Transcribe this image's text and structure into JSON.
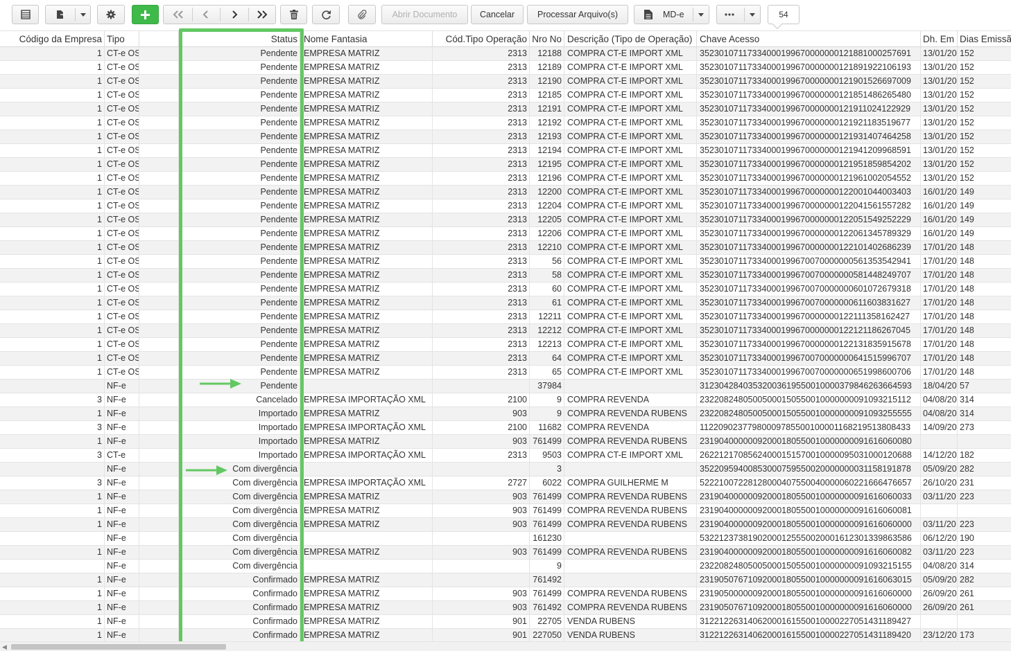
{
  "toolbar": {
    "abrir_label": "Abrir Documento",
    "cancelar_label": "Cancelar",
    "processar_label": "Processar Arquivo(s)",
    "mde_label": "MD-e",
    "page_number": "54",
    "accent_color": "#3fba4a"
  },
  "columns": {
    "codigo": "Código da Empresa",
    "tipo": "Tipo",
    "status": "Status",
    "nome": "Nome Fantasia",
    "codop": "Cód.Tipo Operação",
    "nro": "Nro No",
    "desc": "Descrição (Tipo de Operação)",
    "chave": "Chave Acesso",
    "dh": "Dh. Em",
    "dias": "Dias Emissã"
  },
  "rows": [
    {
      "cod": "1",
      "tipo": "CT-e OS",
      "status": "Pendente",
      "nome": "EMPRESA MATRIZ",
      "codop": "2313",
      "nro": "12188",
      "desc": "COMPRA CT-E IMPORT XML",
      "chave": "35230107117334000199670000000121881000257691",
      "dh": "13/01/20",
      "dias": "152"
    },
    {
      "cod": "1",
      "tipo": "CT-e OS",
      "status": "Pendente",
      "nome": "EMPRESA MATRIZ",
      "codop": "2313",
      "nro": "12189",
      "desc": "COMPRA CT-E IMPORT XML",
      "chave": "35230107117334000199670000000121891922106193",
      "dh": "13/01/20",
      "dias": "152"
    },
    {
      "cod": "1",
      "tipo": "CT-e OS",
      "status": "Pendente",
      "nome": "EMPRESA MATRIZ",
      "codop": "2313",
      "nro": "12190",
      "desc": "COMPRA CT-E IMPORT XML",
      "chave": "35230107117334000199670000000121901526697009",
      "dh": "13/01/20",
      "dias": "152"
    },
    {
      "cod": "1",
      "tipo": "CT-e OS",
      "status": "Pendente",
      "nome": "EMPRESA MATRIZ",
      "codop": "2313",
      "nro": "12185",
      "desc": "COMPRA CT-E IMPORT XML",
      "chave": "35230107117334000199670000000121851486265480",
      "dh": "13/01/20",
      "dias": "152"
    },
    {
      "cod": "1",
      "tipo": "CT-e OS",
      "status": "Pendente",
      "nome": "EMPRESA MATRIZ",
      "codop": "2313",
      "nro": "12191",
      "desc": "COMPRA CT-E IMPORT XML",
      "chave": "35230107117334000199670000000121911024122929",
      "dh": "13/01/20",
      "dias": "152"
    },
    {
      "cod": "1",
      "tipo": "CT-e OS",
      "status": "Pendente",
      "nome": "EMPRESA MATRIZ",
      "codop": "2313",
      "nro": "12192",
      "desc": "COMPRA CT-E IMPORT XML",
      "chave": "35230107117334000199670000000121921183519677",
      "dh": "13/01/20",
      "dias": "152"
    },
    {
      "cod": "1",
      "tipo": "CT-e OS",
      "status": "Pendente",
      "nome": "EMPRESA MATRIZ",
      "codop": "2313",
      "nro": "12193",
      "desc": "COMPRA CT-E IMPORT XML",
      "chave": "35230107117334000199670000000121931407464258",
      "dh": "13/01/20",
      "dias": "152"
    },
    {
      "cod": "1",
      "tipo": "CT-e OS",
      "status": "Pendente",
      "nome": "EMPRESA MATRIZ",
      "codop": "2313",
      "nro": "12194",
      "desc": "COMPRA CT-E IMPORT XML",
      "chave": "35230107117334000199670000000121941209968591",
      "dh": "13/01/20",
      "dias": "152"
    },
    {
      "cod": "1",
      "tipo": "CT-e OS",
      "status": "Pendente",
      "nome": "EMPRESA MATRIZ",
      "codop": "2313",
      "nro": "12195",
      "desc": "COMPRA CT-E IMPORT XML",
      "chave": "35230107117334000199670000000121951859854202",
      "dh": "13/01/20",
      "dias": "152"
    },
    {
      "cod": "1",
      "tipo": "CT-e OS",
      "status": "Pendente",
      "nome": "EMPRESA MATRIZ",
      "codop": "2313",
      "nro": "12196",
      "desc": "COMPRA CT-E IMPORT XML",
      "chave": "35230107117334000199670000000121961002054552",
      "dh": "13/01/20",
      "dias": "152"
    },
    {
      "cod": "1",
      "tipo": "CT-e OS",
      "status": "Pendente",
      "nome": "EMPRESA MATRIZ",
      "codop": "2313",
      "nro": "12200",
      "desc": "COMPRA CT-E IMPORT XML",
      "chave": "35230107117334000199670000000122001044003403",
      "dh": "16/01/20",
      "dias": "149"
    },
    {
      "cod": "1",
      "tipo": "CT-e OS",
      "status": "Pendente",
      "nome": "EMPRESA MATRIZ",
      "codop": "2313",
      "nro": "12204",
      "desc": "COMPRA CT-E IMPORT XML",
      "chave": "35230107117334000199670000000122041561557282",
      "dh": "16/01/20",
      "dias": "149"
    },
    {
      "cod": "1",
      "tipo": "CT-e OS",
      "status": "Pendente",
      "nome": "EMPRESA MATRIZ",
      "codop": "2313",
      "nro": "12205",
      "desc": "COMPRA CT-E IMPORT XML",
      "chave": "35230107117334000199670000000122051549252229",
      "dh": "16/01/20",
      "dias": "149"
    },
    {
      "cod": "1",
      "tipo": "CT-e OS",
      "status": "Pendente",
      "nome": "EMPRESA MATRIZ",
      "codop": "2313",
      "nro": "12206",
      "desc": "COMPRA CT-E IMPORT XML",
      "chave": "35230107117334000199670000000122061345789329",
      "dh": "16/01/20",
      "dias": "149"
    },
    {
      "cod": "1",
      "tipo": "CT-e OS",
      "status": "Pendente",
      "nome": "EMPRESA MATRIZ",
      "codop": "2313",
      "nro": "12210",
      "desc": "COMPRA CT-E IMPORT XML",
      "chave": "35230107117334000199670000000122101402686239",
      "dh": "17/01/20",
      "dias": "148"
    },
    {
      "cod": "1",
      "tipo": "CT-e OS",
      "status": "Pendente",
      "nome": "EMPRESA MATRIZ",
      "codop": "2313",
      "nro": "56",
      "desc": "COMPRA CT-E IMPORT XML",
      "chave": "35230107117334000199670070000000561353542941",
      "dh": "17/01/20",
      "dias": "148"
    },
    {
      "cod": "1",
      "tipo": "CT-e OS",
      "status": "Pendente",
      "nome": "EMPRESA MATRIZ",
      "codop": "2313",
      "nro": "58",
      "desc": "COMPRA CT-E IMPORT XML",
      "chave": "35230107117334000199670070000000581448249707",
      "dh": "17/01/20",
      "dias": "148"
    },
    {
      "cod": "1",
      "tipo": "CT-e OS",
      "status": "Pendente",
      "nome": "EMPRESA MATRIZ",
      "codop": "2313",
      "nro": "60",
      "desc": "COMPRA CT-E IMPORT XML",
      "chave": "35230107117334000199670070000000601072679318",
      "dh": "17/01/20",
      "dias": "148"
    },
    {
      "cod": "1",
      "tipo": "CT-e OS",
      "status": "Pendente",
      "nome": "EMPRESA MATRIZ",
      "codop": "2313",
      "nro": "61",
      "desc": "COMPRA CT-E IMPORT XML",
      "chave": "35230107117334000199670070000000611603831627",
      "dh": "17/01/20",
      "dias": "148"
    },
    {
      "cod": "1",
      "tipo": "CT-e OS",
      "status": "Pendente",
      "nome": "EMPRESA MATRIZ",
      "codop": "2313",
      "nro": "12211",
      "desc": "COMPRA CT-E IMPORT XML",
      "chave": "35230107117334000199670000000122111358162427",
      "dh": "17/01/20",
      "dias": "148"
    },
    {
      "cod": "1",
      "tipo": "CT-e OS",
      "status": "Pendente",
      "nome": "EMPRESA MATRIZ",
      "codop": "2313",
      "nro": "12212",
      "desc": "COMPRA CT-E IMPORT XML",
      "chave": "35230107117334000199670000000122121186267045",
      "dh": "17/01/20",
      "dias": "148"
    },
    {
      "cod": "1",
      "tipo": "CT-e OS",
      "status": "Pendente",
      "nome": "EMPRESA MATRIZ",
      "codop": "2313",
      "nro": "12213",
      "desc": "COMPRA CT-E IMPORT XML",
      "chave": "35230107117334000199670000000122131835915678",
      "dh": "17/01/20",
      "dias": "148"
    },
    {
      "cod": "1",
      "tipo": "CT-e OS",
      "status": "Pendente",
      "nome": "EMPRESA MATRIZ",
      "codop": "2313",
      "nro": "64",
      "desc": "COMPRA CT-E IMPORT XML",
      "chave": "35230107117334000199670070000000641515996707",
      "dh": "17/01/20",
      "dias": "148"
    },
    {
      "cod": "1",
      "tipo": "CT-e OS",
      "status": "Pendente",
      "nome": "EMPRESA MATRIZ",
      "codop": "2313",
      "nro": "65",
      "desc": "COMPRA CT-E IMPORT XML",
      "chave": "35230107117334000199670070000000651998600706",
      "dh": "17/01/20",
      "dias": "148"
    },
    {
      "cod": "",
      "tipo": "NF-e",
      "status": "Pendente",
      "nome": "",
      "codop": "",
      "nro": "37984",
      "desc": "",
      "chave": "31230428403532003619550010000379846263664593",
      "dh": "18/04/20",
      "dias": "57"
    },
    {
      "cod": "3",
      "tipo": "NF-e",
      "status": "Cancelado",
      "nome": "EMPRESA IMPORTAÇÃO XML",
      "codop": "2100",
      "nro": "9",
      "desc": "COMPRA REVENDA",
      "chave": "23220824805005000150550010000000091093215112",
      "dh": "04/08/20",
      "dias": "314"
    },
    {
      "cod": "1",
      "tipo": "NF-e",
      "status": "Importado",
      "nome": "EMPRESA MATRIZ",
      "codop": "903",
      "nro": "9",
      "desc": "COMPRA REVENDA RUBENS",
      "chave": "23220824805005000150550010000000091093255555",
      "dh": "04/08/20",
      "dias": "314"
    },
    {
      "cod": "3",
      "tipo": "NF-e",
      "status": "Importado",
      "nome": "EMPRESA IMPORTAÇÃO XML",
      "codop": "2100",
      "nro": "11682",
      "desc": "COMPRA REVENDA",
      "chave": "11220902377980009785500100001168219513808433",
      "dh": "14/09/20",
      "dias": "273"
    },
    {
      "cod": "1",
      "tipo": "NF-e",
      "status": "Importado",
      "nome": "EMPRESA MATRIZ",
      "codop": "903",
      "nro": "761499",
      "desc": "COMPRA REVENDA RUBENS",
      "chave": "23190400000092000180550010000000091616060080",
      "dh": "",
      "dias": ""
    },
    {
      "cod": "3",
      "tipo": "CT-e",
      "status": "Importado",
      "nome": "EMPRESA IMPORTAÇÃO XML",
      "codop": "2313",
      "nro": "9503",
      "desc": "COMPRA CT-E IMPORT XML",
      "chave": "26221217085624000151570010000095031000120688",
      "dh": "14/12/20",
      "dias": "182"
    },
    {
      "cod": "",
      "tipo": "NF-e",
      "status": "Com divergência",
      "nome": "",
      "codop": "",
      "nro": "3",
      "desc": "",
      "chave": "35220959400853000759550020000000031158191878",
      "dh": "05/09/20",
      "dias": "282"
    },
    {
      "cod": "3",
      "tipo": "NF-e",
      "status": "Com divergência",
      "nome": "EMPRESA IMPORTAÇÃO XML",
      "codop": "2727",
      "nro": "6022",
      "desc": "COMPRA GUILHERME M",
      "chave": "52221007228128000407550040000060221666476657",
      "dh": "26/10/20",
      "dias": "231"
    },
    {
      "cod": "1",
      "tipo": "NF-e",
      "status": "Com divergência",
      "nome": "EMPRESA MATRIZ",
      "codop": "903",
      "nro": "761499",
      "desc": "COMPRA REVENDA RUBENS",
      "chave": "23190400000092000180550010000000091616060033",
      "dh": "03/11/20",
      "dias": "223"
    },
    {
      "cod": "1",
      "tipo": "NF-e",
      "status": "Com divergência",
      "nome": "EMPRESA MATRIZ",
      "codop": "903",
      "nro": "761499",
      "desc": "COMPRA REVENDA RUBENS",
      "chave": "23190400000092000180550010000000091616060081",
      "dh": "",
      "dias": ""
    },
    {
      "cod": "1",
      "tipo": "NF-e",
      "status": "Com divergência",
      "nome": "EMPRESA MATRIZ",
      "codop": "903",
      "nro": "761499",
      "desc": "COMPRA REVENDA RUBENS",
      "chave": "23190400000092000180550010000000091616060000",
      "dh": "03/11/20",
      "dias": "223"
    },
    {
      "cod": "",
      "tipo": "NF-e",
      "status": "Com divergência",
      "nome": "",
      "codop": "",
      "nro": "161230",
      "desc": "",
      "chave": "53221237381902000125550020001612301339863586",
      "dh": "06/12/20",
      "dias": "190"
    },
    {
      "cod": "1",
      "tipo": "NF-e",
      "status": "Com divergência",
      "nome": "EMPRESA MATRIZ",
      "codop": "903",
      "nro": "761499",
      "desc": "COMPRA REVENDA RUBENS",
      "chave": "23190400000092000180550010000000091616060082",
      "dh": "03/11/20",
      "dias": "223"
    },
    {
      "cod": "",
      "tipo": "NF-e",
      "status": "Com divergência",
      "nome": "",
      "codop": "",
      "nro": "9",
      "desc": "",
      "chave": "23220824805005000150550010000000091093215155",
      "dh": "04/08/20",
      "dias": "314"
    },
    {
      "cod": "1",
      "tipo": "NF-e",
      "status": "Confirmado",
      "nome": "EMPRESA MATRIZ",
      "codop": "",
      "nro": "761492",
      "desc": "",
      "chave": "23190507671092000180550010000000091616063015",
      "dh": "05/09/20",
      "dias": "282"
    },
    {
      "cod": "1",
      "tipo": "NF-e",
      "status": "Confirmado",
      "nome": "EMPRESA MATRIZ",
      "codop": "903",
      "nro": "761499",
      "desc": "COMPRA REVENDA RUBENS",
      "chave": "23190500000092000180550010000000091616060000",
      "dh": "26/09/20",
      "dias": "261"
    },
    {
      "cod": "1",
      "tipo": "NF-e",
      "status": "Confirmado",
      "nome": "EMPRESA MATRIZ",
      "codop": "903",
      "nro": "761492",
      "desc": "COMPRA REVENDA RUBENS",
      "chave": "23190507671092000180550010000000091616060000",
      "dh": "26/09/20",
      "dias": "261"
    },
    {
      "cod": "1",
      "tipo": "NF-e",
      "status": "Confirmado",
      "nome": "EMPRESA MATRIZ",
      "codop": "901",
      "nro": "22705",
      "desc": "VENDA RUBENS",
      "chave": "31221226314062000161550010000227051431189427",
      "dh": "",
      "dias": ""
    },
    {
      "cod": "1",
      "tipo": "NF-e",
      "status": "Confirmado",
      "nome": "EMPRESA MATRIZ",
      "codop": "901",
      "nro": "227050",
      "desc": "VENDA RUBENS",
      "chave": "31221226314062000161550010000227051431189420",
      "dh": "23/12/20",
      "dias": "173"
    }
  ]
}
